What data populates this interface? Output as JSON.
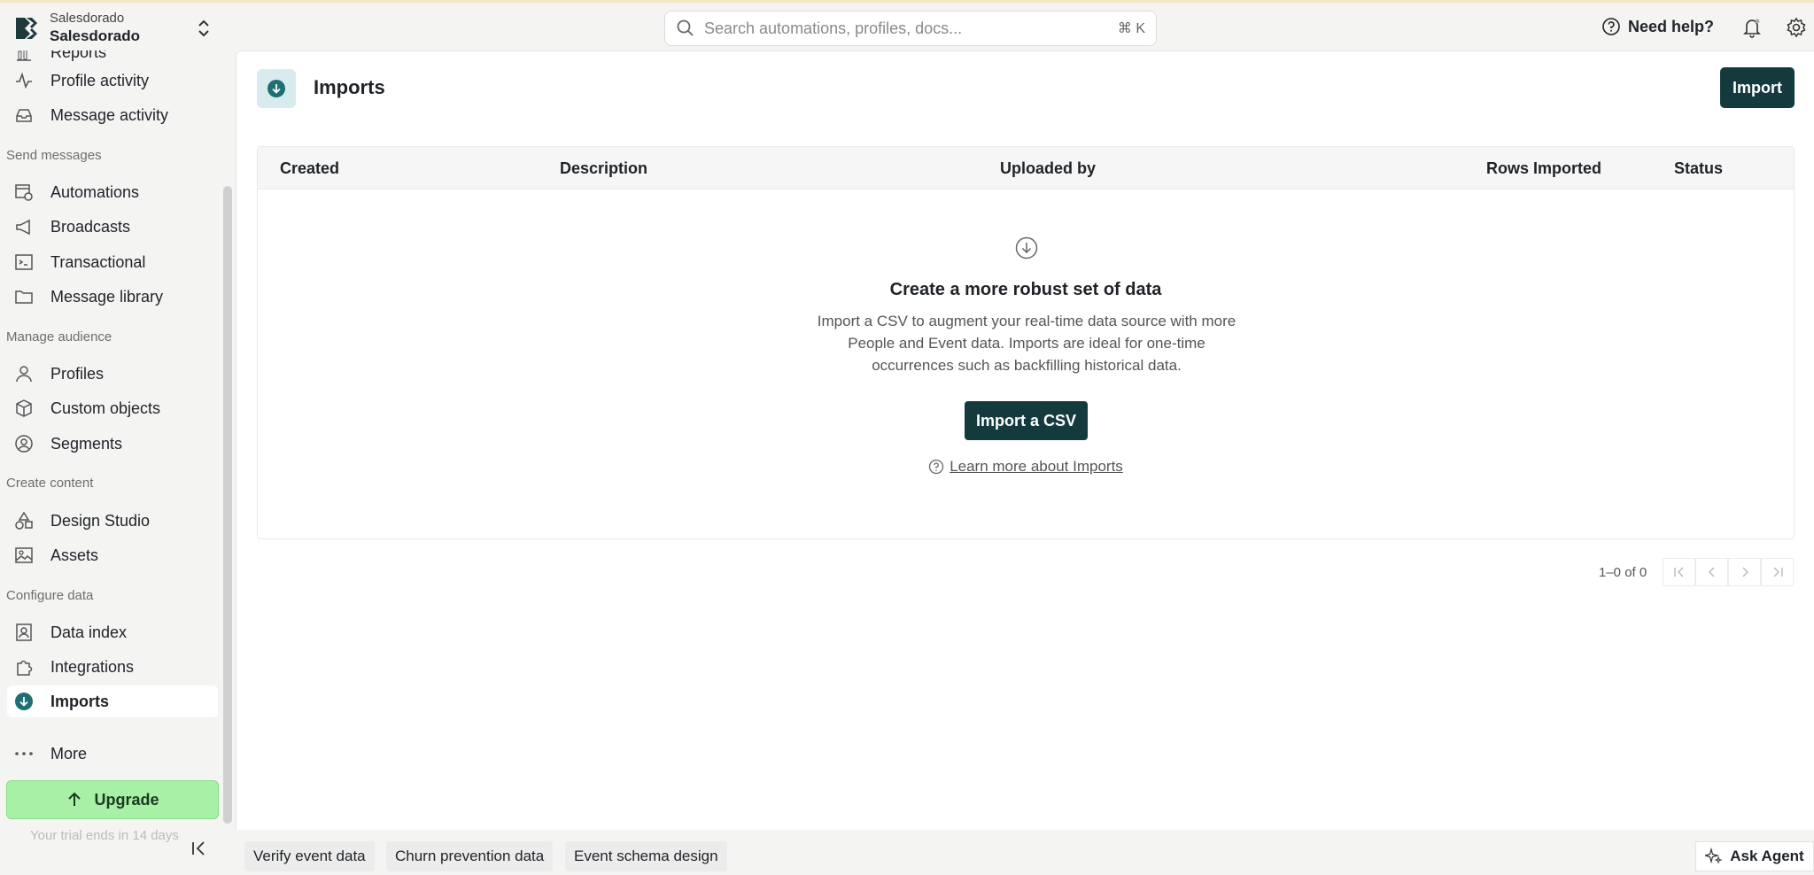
{
  "org": {
    "workspace": "Salesdorado",
    "name": "Salesdorado"
  },
  "search": {
    "placeholder": "Search automations, profiles, docs...",
    "shortcut": "⌘ K"
  },
  "header": {
    "help_label": "Need help?"
  },
  "sidebar": {
    "partial_item": "Reports",
    "items_top": [
      {
        "label": "Profile activity",
        "icon": "activity-icon"
      },
      {
        "label": "Message activity",
        "icon": "inbox-icon"
      }
    ],
    "sections": [
      {
        "title": "Send messages",
        "items": [
          "Automations",
          "Broadcasts",
          "Transactional",
          "Message library"
        ]
      },
      {
        "title": "Manage audience",
        "items": [
          "Profiles",
          "Custom objects",
          "Segments"
        ]
      },
      {
        "title": "Create content",
        "items": [
          "Design Studio",
          "Assets"
        ]
      },
      {
        "title": "Configure data",
        "items": [
          "Data index",
          "Integrations",
          "Imports"
        ]
      }
    ],
    "more_label": "More",
    "upgrade_label": "Upgrade",
    "trial_text": "Your trial ends in 14 days"
  },
  "page": {
    "title": "Imports",
    "import_button": "Import",
    "columns": [
      "Created",
      "Description",
      "Uploaded by",
      "Rows Imported",
      "Status"
    ],
    "empty": {
      "title": "Create a more robust set of data",
      "description": "Import a CSV to augment your real-time data source with more People and Event data. Imports are ideal for one-time occurrences such as backfilling historical data.",
      "button": "Import a CSV",
      "learn_link": "Learn more about Imports"
    },
    "pagination": "1–0 of 0"
  },
  "bottom": {
    "chips": [
      "Verify event data",
      "Churn prevention data",
      "Event schema design"
    ],
    "agent_label": "Ask Agent"
  },
  "colors": {
    "primary": "#143a3e",
    "upgrade": "#a7f0a5",
    "accent": "#1d6f73"
  }
}
